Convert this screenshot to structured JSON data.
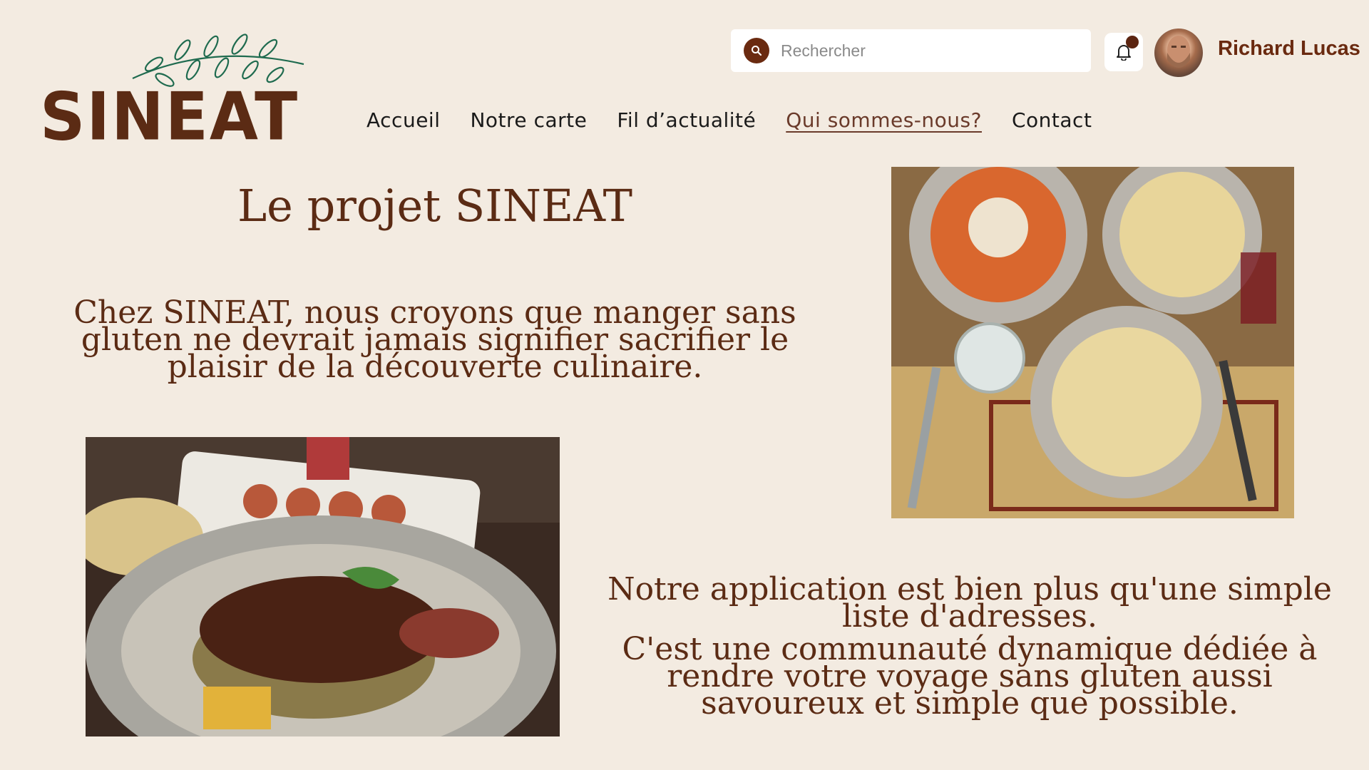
{
  "logo": {
    "text": "SINEAT"
  },
  "search": {
    "placeholder": "Rechercher",
    "icon": "search-icon"
  },
  "notifications": {
    "icon": "bell-icon",
    "has_unread": true
  },
  "user": {
    "name": "Richard Lucas"
  },
  "nav": [
    {
      "label": "Accueil",
      "active": false
    },
    {
      "label": "Notre carte",
      "active": false
    },
    {
      "label": "Fil d’actualité",
      "active": false
    },
    {
      "label": "Qui sommes-nous?",
      "active": true
    },
    {
      "label": "Contact",
      "active": false
    }
  ],
  "main": {
    "title": "Le projet SINEAT",
    "intro": "Chez SINEAT, nous croyons que manger sans gluten ne devrait jamais signifier sacrifier le plaisir de la découverte culinaire.",
    "outro_1": "Notre application est bien plus qu'une simple liste d'adresses.",
    "outro_2": "C'est une communauté dynamique dédiée à rendre votre voyage sans gluten aussi savoureux et simple que possible."
  },
  "colors": {
    "brand": "#5b2b14",
    "background": "#f3ebe1",
    "leaf": "#1f6b4f"
  }
}
